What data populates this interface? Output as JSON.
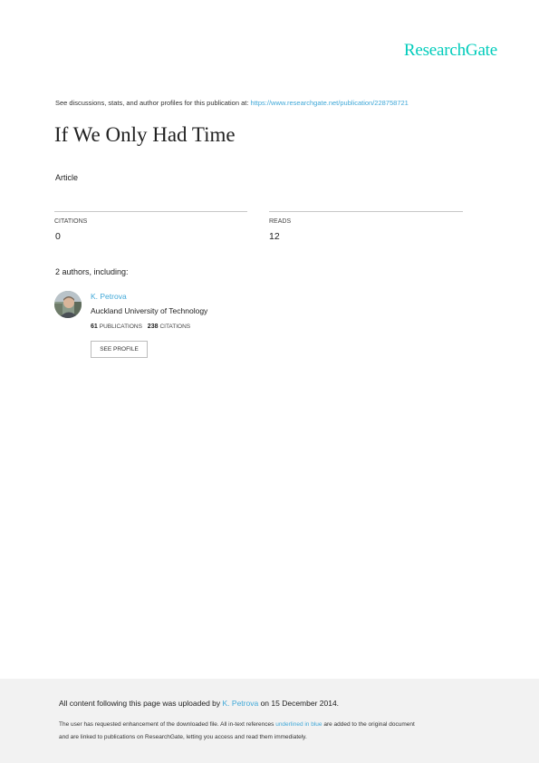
{
  "brand": {
    "logo_text": "ResearchGate",
    "accent_color": "#00ccbb",
    "link_color": "#40a8d8"
  },
  "header": {
    "discussion_text": "See discussions, stats, and author profiles for this publication at: ",
    "publication_url": "https://www.researchgate.net/publication/228758721"
  },
  "publication": {
    "title": "If We Only Had Time",
    "type": "Article"
  },
  "stats": {
    "citations_label": "CITATIONS",
    "citations_value": "0",
    "reads_label": "READS",
    "reads_value": "12"
  },
  "authors": {
    "heading": "2 authors, including:",
    "list": [
      {
        "name": "K. Petrova",
        "affiliation": "Auckland University of Technology",
        "publications_count": "61",
        "publications_label": "PUBLICATIONS",
        "citations_count": "238",
        "citations_label": "CITATIONS",
        "button_label": "SEE PROFILE",
        "avatar_icon": "author-photo"
      }
    ]
  },
  "footer": {
    "upload_prefix": "All content following this page was uploaded by ",
    "uploader": "K. Petrova",
    "upload_suffix": " on 15 December 2014.",
    "note_line1_prefix": "The user has requested enhancement of the downloaded file. All in-text references ",
    "note_line1_link": "underlined in blue",
    "note_line1_suffix": " are added to the original document",
    "note_line2": "and are linked to publications on ResearchGate, letting you access and read them immediately."
  }
}
